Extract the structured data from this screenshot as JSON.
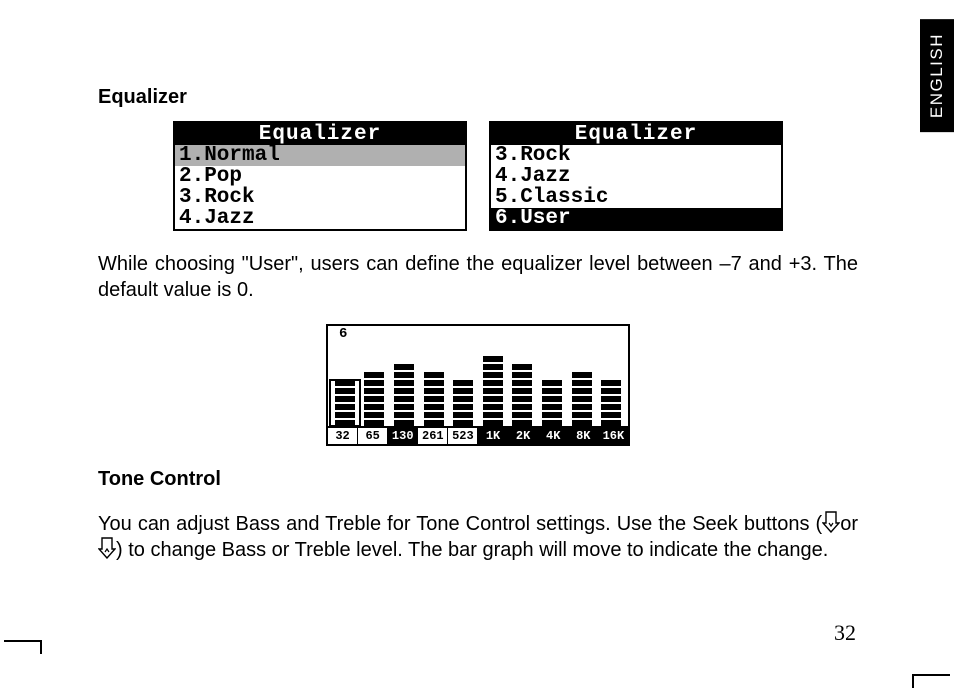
{
  "lang_tab": "ENGLISH",
  "section1": {
    "heading": "Equalizer",
    "screen_left": {
      "title": "Equalizer",
      "rows": [
        "1.Normal",
        "2.Pop",
        "3.Rock",
        "4.Jazz"
      ],
      "selected_index": 0,
      "selected_style": "grey"
    },
    "screen_right": {
      "title": "Equalizer",
      "rows": [
        "3.Rock",
        "4.Jazz",
        "5.Classic",
        "6.User"
      ],
      "selected_index": 3,
      "selected_style": "black"
    },
    "body": "While choosing \"User\", users can define the equalizer level between –7 and +3. The default value is 0."
  },
  "chart_data": {
    "type": "bar",
    "title": "",
    "xlabel": "",
    "ylabel": "",
    "ylim": [
      -7,
      3
    ],
    "current_level_label": "6",
    "selected_band_index": 0,
    "categories": [
      "32",
      "65",
      "130",
      "261",
      "523",
      "1K",
      "2K",
      "4K",
      "8K",
      "16K"
    ],
    "label_inverted": [
      false,
      false,
      true,
      false,
      false,
      true,
      true,
      true,
      true,
      true
    ],
    "values_segments": [
      6,
      7,
      8,
      7,
      6,
      9,
      8,
      6,
      7,
      6
    ]
  },
  "section2": {
    "heading": "Tone Control",
    "body_part1": "You can adjust Bass and Treble for Tone Control settings. Use the Seek buttons (",
    "body_mid": "or ",
    "body_part2": ") to change Bass or Treble level. The bar graph will move to indicate the change."
  },
  "icons": {
    "seek_down": "seek-down-icon",
    "seek_up": "seek-up-icon"
  },
  "page_number": "32"
}
